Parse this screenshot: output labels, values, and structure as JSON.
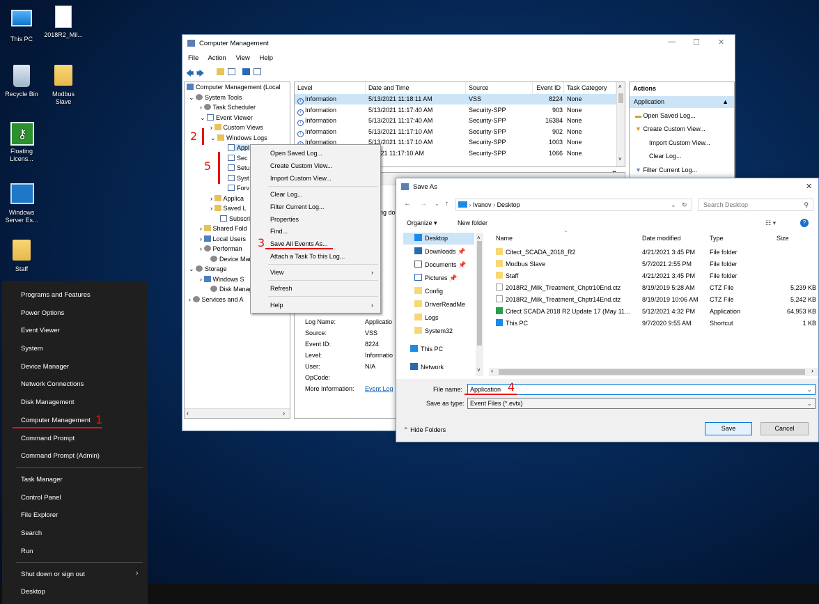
{
  "desktop": {
    "icons": [
      {
        "label": "This PC",
        "icon": "computer-icon"
      },
      {
        "label": "2018R2_Mil...",
        "icon": "file-icon"
      },
      {
        "label": "Recycle Bin",
        "icon": "recycle-bin-icon"
      },
      {
        "label": "Modbus Slave",
        "icon": "folder-icon"
      },
      {
        "label": "Floating Licens...",
        "icon": "key-icon"
      },
      {
        "label": "Windows Server Es...",
        "icon": "server-icon"
      },
      {
        "label": "Staff",
        "icon": "folder-icon"
      }
    ]
  },
  "winx_menu": {
    "items": [
      "Programs and Features",
      "Power Options",
      "Event Viewer",
      "System",
      "Device Manager",
      "Network Connections",
      "Disk Management",
      "Computer Management",
      "Command Prompt",
      "Command Prompt (Admin)",
      "Task Manager",
      "Control Panel",
      "File Explorer",
      "Search",
      "Run",
      "Shut down or sign out",
      "Desktop"
    ]
  },
  "computer_management": {
    "title": "Computer Management",
    "menu": [
      "File",
      "Action",
      "View",
      "Help"
    ],
    "tree": [
      "Computer Management (Local",
      "System Tools",
      "Task Scheduler",
      "Event Viewer",
      "Custom Views",
      "Windows Logs",
      "Appl",
      "Sec",
      "Setu",
      "Syst",
      "Forv",
      "Applica",
      "Saved L",
      "Subscri",
      "Shared Fold",
      "Local Users",
      "Performan",
      "Device Mar",
      "Storage",
      "Windows S",
      "Disk Manag",
      "Services and A"
    ],
    "events": {
      "columns": [
        "Level",
        "Date and Time",
        "Source",
        "Event ID",
        "Task Category"
      ],
      "rows": [
        [
          "Information",
          "5/13/2021 11:18:11 AM",
          "VSS",
          "8224",
          "None"
        ],
        [
          "Information",
          "5/13/2021 11:17:40 AM",
          "Security-SPP",
          "903",
          "None"
        ],
        [
          "Information",
          "5/13/2021 11:17:40 AM",
          "Security-SPP",
          "16384",
          "None"
        ],
        [
          "Information",
          "5/13/2021 11:17:10 AM",
          "Security-SPP",
          "902",
          "None"
        ],
        [
          "Information",
          "5/13/2021 11:17:10 AM",
          "Security-SPP",
          "1003",
          "None"
        ],
        [
          "",
          "3/2021 11:17:10 AM",
          "Security-SPP",
          "1066",
          "None"
        ]
      ]
    },
    "detail": {
      "fragment": "ng do",
      "labels": [
        "Log Name:",
        "Source:",
        "Event ID:",
        "Level:",
        "User:",
        "OpCode:",
        "More Information:"
      ],
      "values": [
        "Applicatio",
        "VSS",
        "8224",
        "Informatio",
        "N/A",
        "",
        "Event Log"
      ]
    },
    "actions": {
      "header": "Actions",
      "section": "Application",
      "items": [
        "Open Saved Log...",
        "Create Custom View...",
        "Import Custom View...",
        "Clear Log...",
        "Filter Current Log..."
      ]
    }
  },
  "context_menu": {
    "items": [
      "Open Saved Log...",
      "Create Custom View...",
      "Import Custom View...",
      "Clear Log...",
      "Filter Current Log...",
      "Properties",
      "Find...",
      "Save All Events As...",
      "Attach a Task To this Log...",
      "View",
      "Refresh",
      "Help"
    ]
  },
  "save_as": {
    "title": "Save As",
    "breadcrumb": [
      "Ivanov",
      "Desktop"
    ],
    "search_placeholder": "Search Desktop",
    "toolbar": {
      "organize": "Organize ▾",
      "new_folder": "New folder"
    },
    "nav": [
      "Desktop",
      "Downloads",
      "Documents",
      "Pictures",
      "Config",
      "DriverReadMe",
      "Logs",
      "System32",
      "This PC",
      "Network"
    ],
    "columns": [
      "Name",
      "Date modified",
      "Type",
      "Size"
    ],
    "files": [
      [
        "Citect_SCADA_2018_R2",
        "4/21/2021 3:45 PM",
        "File folder",
        ""
      ],
      [
        "Modbus Slave",
        "5/7/2021 2:55 PM",
        "File folder",
        ""
      ],
      [
        "Staff",
        "4/21/2021 3:45 PM",
        "File folder",
        ""
      ],
      [
        "2018R2_Milk_Treatment_Chptr10End.ctz",
        "8/19/2019 5:28 AM",
        "CTZ File",
        "5,239 KB"
      ],
      [
        "2018R2_Milk_Treatment_Chptr14End.ctz",
        "8/19/2019 10:06 AM",
        "CTZ File",
        "5,242 KB"
      ],
      [
        "Citect SCADA 2018 R2 Update 17 (May 11...",
        "5/12/2021 4:32 PM",
        "Application",
        "64,953 KB"
      ],
      [
        "This PC",
        "9/7/2020 9:55 AM",
        "Shortcut",
        "1 KB"
      ]
    ],
    "file_name_label": "File name:",
    "file_name_value": "Application",
    "save_type_label": "Save as type:",
    "save_type_value": "Event Files (*.evtx)",
    "hide_folders": "Hide Folders",
    "save_button": "Save",
    "cancel_button": "Cancel"
  },
  "annotations": [
    "1",
    "2",
    "3",
    "4",
    "5"
  ],
  "colors": {
    "annotation": "#e81010",
    "selection": "#cce4f7",
    "accent": "#0078d7"
  }
}
